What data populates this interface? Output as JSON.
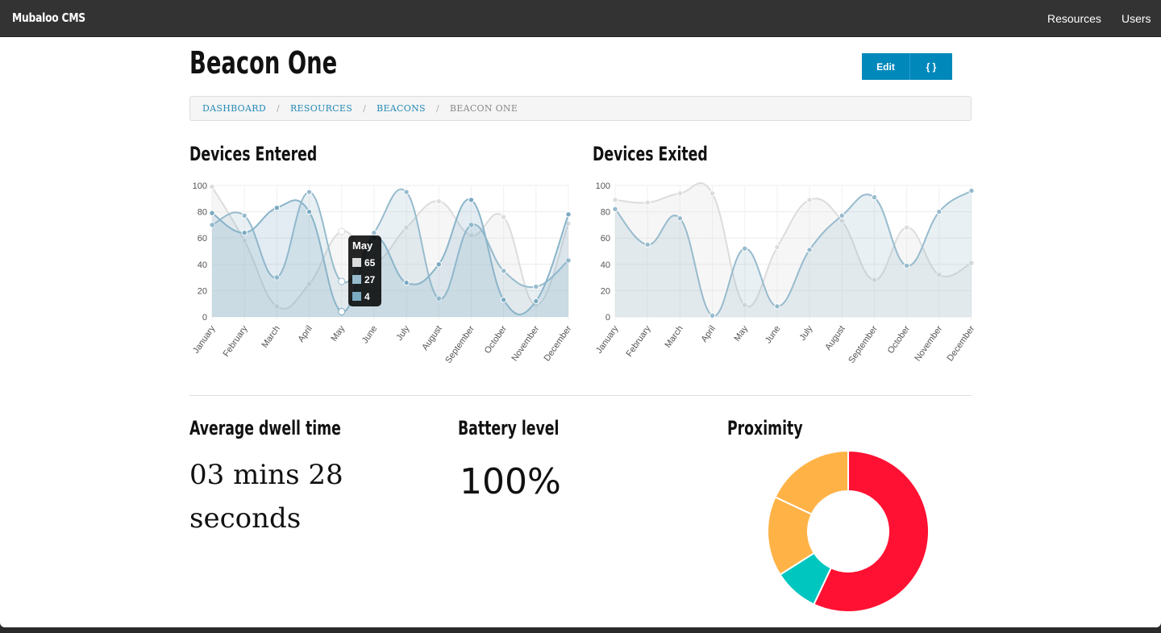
{
  "navbar": {
    "brand": "Mubaloo CMS",
    "links": [
      "Resources",
      "Users"
    ]
  },
  "page": {
    "title": "Beacon One",
    "buttons": {
      "edit": "Edit",
      "json": "{ }"
    }
  },
  "breadcrumb": {
    "items": [
      "DASHBOARD",
      "RESOURCES",
      "BEACONS"
    ],
    "current": "BEACON ONE"
  },
  "sections": {
    "entered_title": "Devices Entered",
    "exited_title": "Devices Exited",
    "dwell_title": "Average dwell time",
    "battery_title": "Battery level",
    "proximity_title": "Proximity"
  },
  "stats": {
    "dwell_value": "03 mins 28 seconds",
    "battery_value": "100%"
  },
  "tooltip": {
    "title": "May",
    "rows": [
      "65",
      "27",
      "4"
    ]
  },
  "colors": {
    "series_grey": "#dcdcdc",
    "series_blue": "#97bbcd",
    "series_blue_dark": "#7aa9c2",
    "proximity_red": "#ff1133",
    "proximity_teal": "#00c6c0",
    "proximity_orange": "#ffb347",
    "button_blue": "#0088bb"
  },
  "chart_data": [
    {
      "type": "line",
      "title": "Devices Entered",
      "x": [
        "January",
        "February",
        "March",
        "April",
        "May",
        "June",
        "July",
        "August",
        "September",
        "October",
        "November",
        "December"
      ],
      "ylim": [
        0,
        100
      ],
      "yticks": [
        0,
        20,
        40,
        60,
        80,
        100
      ],
      "grid": true,
      "series": [
        {
          "values": [
            99,
            58,
            8,
            25,
            65,
            42,
            68,
            88,
            62,
            76,
            9,
            71
          ]
        },
        {
          "values": [
            70,
            77,
            30,
            95,
            27,
            64,
            95,
            14,
            70,
            35,
            23,
            43
          ]
        },
        {
          "values": [
            79,
            64,
            83,
            80,
            4,
            60,
            26,
            40,
            89,
            13,
            12,
            78
          ]
        }
      ]
    },
    {
      "type": "line",
      "title": "Devices Exited",
      "x": [
        "January",
        "February",
        "March",
        "April",
        "May",
        "June",
        "July",
        "August",
        "September",
        "October",
        "November",
        "December"
      ],
      "ylim": [
        0,
        100
      ],
      "yticks": [
        0,
        20,
        40,
        60,
        80,
        100
      ],
      "grid": true,
      "series": [
        {
          "values": [
            89,
            87,
            94,
            94,
            9,
            53,
            89,
            73,
            28,
            68,
            32,
            41
          ]
        },
        {
          "values": [
            82,
            55,
            75,
            1,
            52,
            8,
            51,
            77,
            91,
            39,
            80,
            96
          ]
        }
      ]
    },
    {
      "type": "pie",
      "title": "Proximity",
      "slices": [
        {
          "value": 57,
          "color": "#ff1133"
        },
        {
          "value": 9,
          "color": "#00c6c0"
        },
        {
          "value": 16,
          "color": "#ffb347"
        },
        {
          "value": 18,
          "color": "#ffb347"
        }
      ]
    }
  ]
}
